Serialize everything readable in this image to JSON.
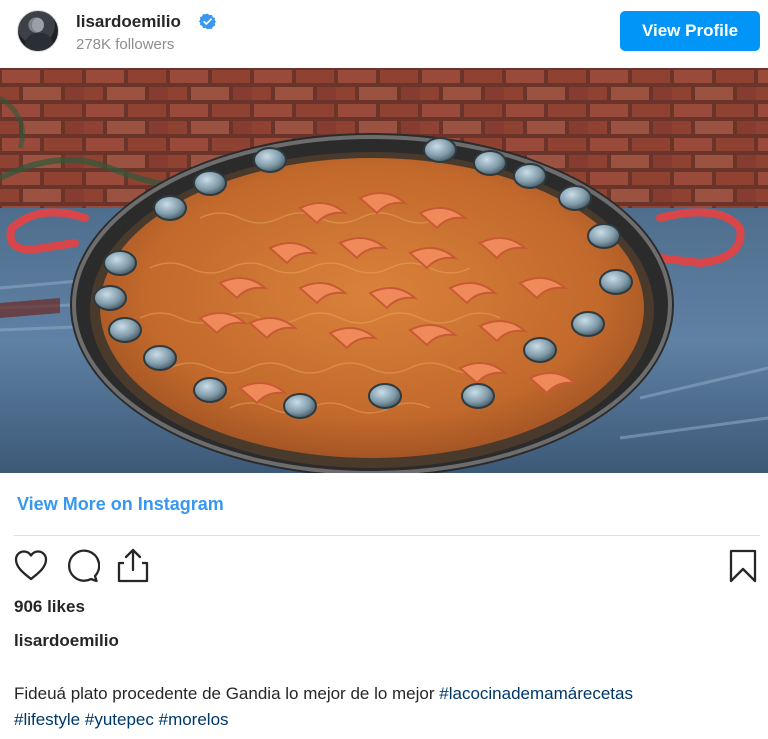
{
  "header": {
    "username": "lisardoemilio",
    "followers": "278K followers",
    "verified_icon": "verified-badge-icon",
    "view_profile_label": "View Profile",
    "accent": "#0095f6"
  },
  "post": {
    "image_icon": "food-photo",
    "view_more_label": "View More on Instagram",
    "link_color": "#3897f0",
    "actions": {
      "like_icon": "heart-icon",
      "comment_icon": "comment-icon",
      "share_icon": "share-icon",
      "save_icon": "bookmark-icon"
    },
    "likes": "906 likes",
    "caption_user": "lisardoemilio",
    "caption_text": "Fideuá plato procedente de Gandia lo mejor de lo mejor ",
    "hashtags": [
      "#lacocinademamárecetas",
      "#lifestyle",
      "#yutepec",
      "#morelos"
    ]
  }
}
